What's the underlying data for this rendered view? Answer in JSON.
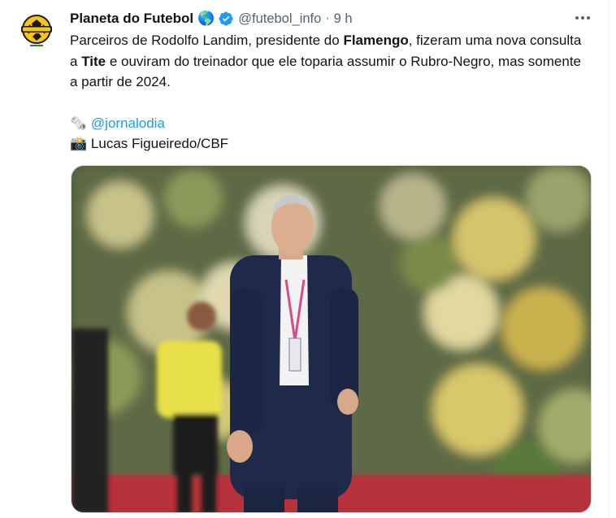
{
  "tweet": {
    "author_name": "Planeta do Futebol",
    "globe_emoji": "🌎",
    "handle": "@futebol_info",
    "separator": "·",
    "time": "9 h",
    "text": {
      "line1_part1": "Parceiros de Rodolfo Landim, presidente do ",
      "line1_bold": "Flamengo",
      "line1_part2": ", fizeram uma nova consulta a ",
      "line2_bold": "Tite",
      "line2_part": " e ouviram do treinador que ele toparia assumir o Rubro-Negro, mas somente a partir de 2024.",
      "credit_link_emoji": "🗞️",
      "credit_link": "@jornalodia",
      "credit_photo_emoji": "📸",
      "credit_photo": "Lucas Figueiredo/CBF"
    }
  },
  "colors": {
    "link": "#1d9bf0",
    "secondary_text": "#536471",
    "verified_badge": "#1d9bf0",
    "avatar_ball": "#f5c518"
  },
  "icons": [
    "verified-badge-icon",
    "more-options-icon",
    "globe-emoji-icon",
    "newspaper-emoji-icon",
    "camera-emoji-icon"
  ]
}
